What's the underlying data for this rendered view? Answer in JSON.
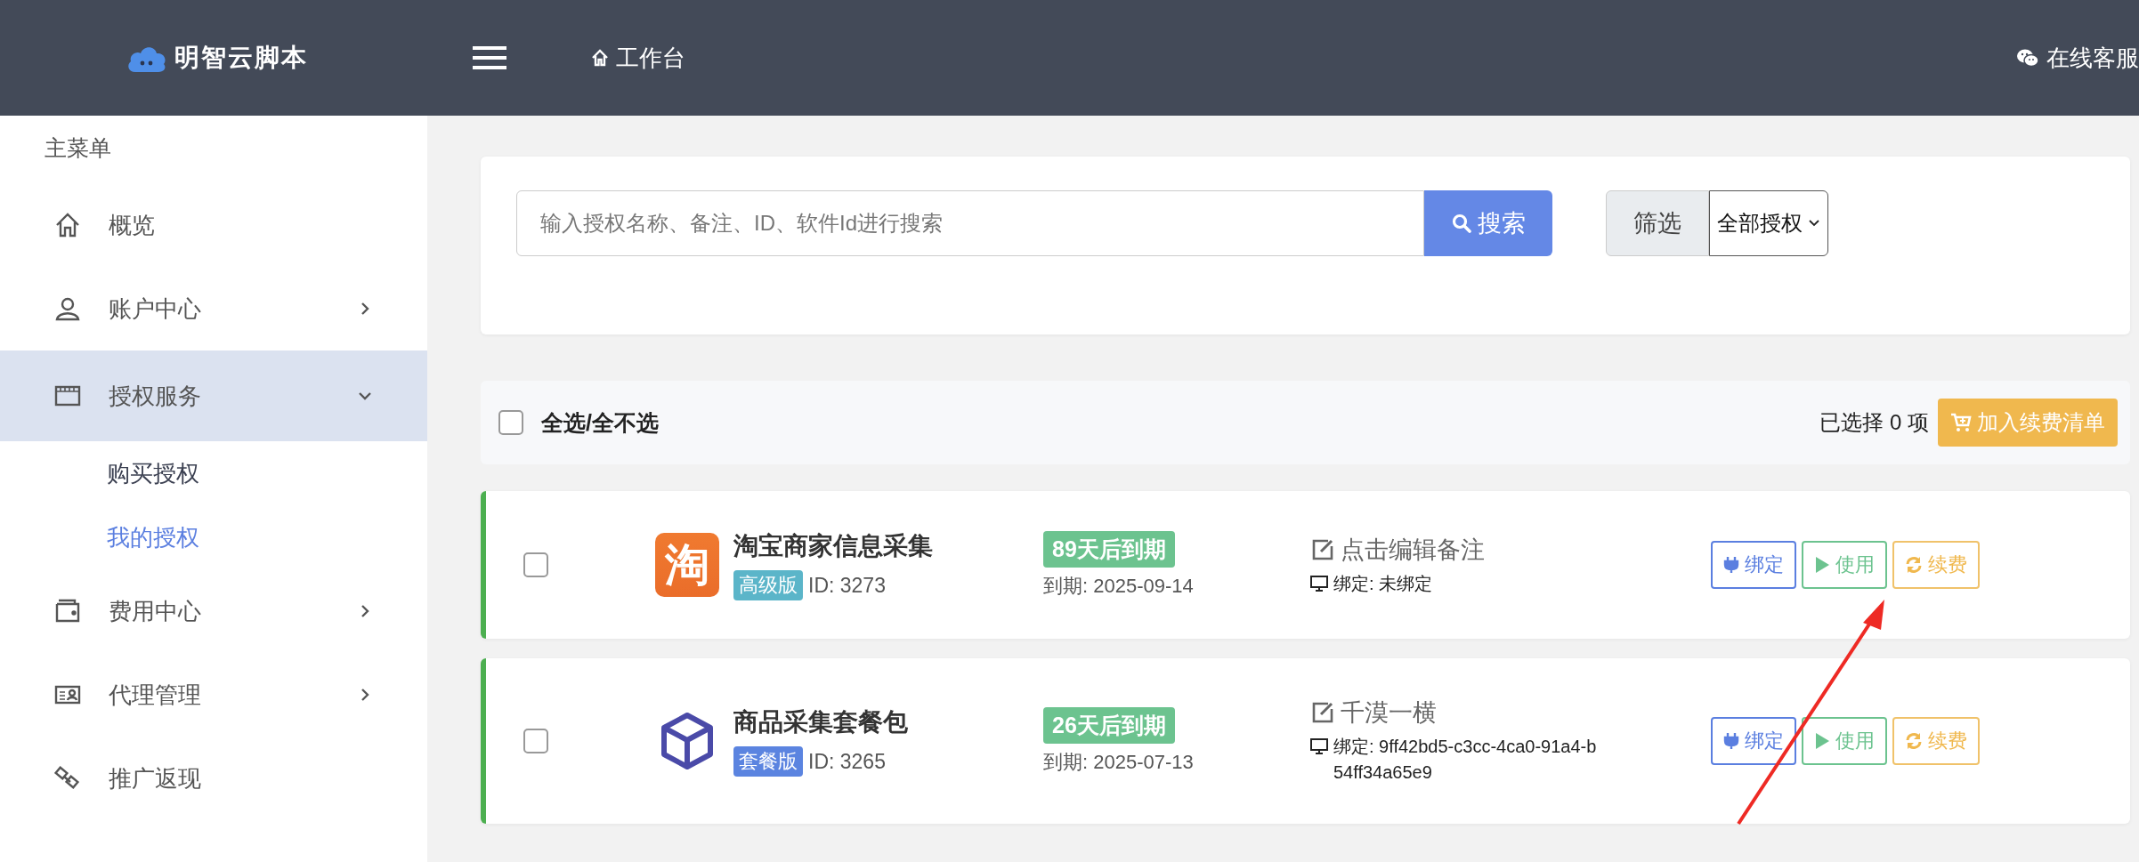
{
  "header": {
    "logo": "明智云脚本",
    "nav": "工作台",
    "service": "在线客服"
  },
  "sidebar": {
    "title": "主菜单",
    "items": [
      {
        "label": "概览",
        "kind": "link"
      },
      {
        "label": "账户中心",
        "kind": "group",
        "expanded": false
      },
      {
        "label": "授权服务",
        "kind": "group",
        "expanded": true,
        "children": [
          {
            "label": "购买授权",
            "selected": false
          },
          {
            "label": "我的授权",
            "selected": true
          }
        ]
      },
      {
        "label": "费用中心",
        "kind": "group",
        "expanded": false
      },
      {
        "label": "代理管理",
        "kind": "group",
        "expanded": false
      },
      {
        "label": "推广返现",
        "kind": "link"
      }
    ]
  },
  "search": {
    "placeholder": "输入授权名称、备注、ID、软件Id进行搜索",
    "button": "搜索",
    "filter_label": "筛选",
    "filter_value": "全部授权"
  },
  "toolbar": {
    "select_all": "全选/全不选",
    "checked": false,
    "selected_count": "已选择 0 项",
    "cart_button": "加入续费清单"
  },
  "licenses": [
    {
      "checked": false,
      "kind": "taobao",
      "logo_text": "淘",
      "name": "淘宝商家信息采集",
      "tier": "高级版",
      "color": "#5bb5c9",
      "id": "ID: 3273",
      "remaining": "89天后到期",
      "expires": "到期: 2025-09-14",
      "note": "点击编辑备注",
      "binding": "绑定: 未绑定",
      "buttons": [
        "绑定",
        "使用",
        "续费"
      ]
    },
    {
      "checked": false,
      "kind": "cube",
      "name": "商品采集套餐包",
      "tier": "套餐版",
      "color": "#5b84e0",
      "id": "ID: 3265",
      "remaining": "26天后到期",
      "expires": "到期: 2025-07-13",
      "note": "千漠一横",
      "binding": "绑定: 9ff42bd5-c3cc-4ca0-91a4-b54ff34a65e9",
      "buttons": [
        "绑定",
        "使用",
        "续费"
      ]
    }
  ]
}
